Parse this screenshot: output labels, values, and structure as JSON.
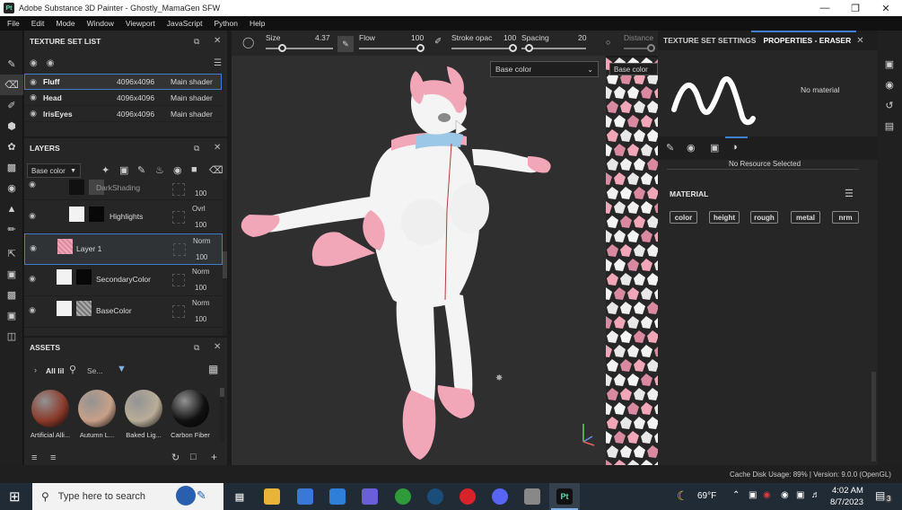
{
  "app": {
    "title": "Adobe Substance 3D Painter - Ghostly_MamaGen SFW",
    "logo_text": "Pt"
  },
  "menu": [
    "File",
    "Edit",
    "Mode",
    "Window",
    "Viewport",
    "JavaScript",
    "Python",
    "Help"
  ],
  "tool_options": {
    "size_label": "Size",
    "size_value": "4.37",
    "flow_label": "Flow",
    "flow_value": "100",
    "stroke_label": "Stroke opac",
    "stroke_value": "100",
    "spacing_label": "Spacing",
    "spacing_value": "20",
    "distance_label": "Distance"
  },
  "texture_set_list": {
    "title": "TEXTURE SET LIST",
    "rows": [
      {
        "name": "Fluff",
        "res": "4096x4096",
        "shader": "Main shader",
        "selected": true
      },
      {
        "name": "Head",
        "res": "4096x4096",
        "shader": "Main shader",
        "selected": false
      },
      {
        "name": "IrisEyes",
        "res": "4096x4096",
        "shader": "Main shader",
        "selected": false
      }
    ]
  },
  "layers": {
    "title": "LAYERS",
    "channel": "Base color",
    "items": [
      {
        "name": "DarkShading",
        "blend": "",
        "opacity": "100",
        "selected": false
      },
      {
        "name": "Highlights",
        "blend": "Ovrl",
        "opacity": "100",
        "selected": false
      },
      {
        "name": "Layer 1",
        "blend": "Norm",
        "opacity": "100",
        "selected": true
      },
      {
        "name": "SecondaryColor",
        "blend": "Norm",
        "opacity": "100",
        "selected": false
      },
      {
        "name": "BaseColor",
        "blend": "Norm",
        "opacity": "100",
        "selected": false
      }
    ]
  },
  "assets": {
    "title": "ASSETS",
    "filter_label": "All lil",
    "search_placeholder": "Se...",
    "items": [
      {
        "name": "Artificial Alli...",
        "color": "#8a3a2a"
      },
      {
        "name": "Autumn L...",
        "color": "#c8a088"
      },
      {
        "name": "Baked Lig...",
        "color": "#b9ad98"
      },
      {
        "name": "Carbon Fiber",
        "color": "#111111"
      }
    ]
  },
  "viewport": {
    "channel_select": "Base color",
    "uv_label": "Base color"
  },
  "right_panel": {
    "tab_settings": "TEXTURE SET SETTINGS",
    "tab_properties": "PROPERTIES - ERASER",
    "no_material": "No material",
    "no_resource": "No Resource Selected",
    "material_title": "MATERIAL",
    "channels": [
      "color",
      "height",
      "rough",
      "metal",
      "nrm"
    ]
  },
  "status": {
    "text": "Cache Disk Usage:   89% | Version: 9.0.0 (OpenGL)"
  },
  "taskbar": {
    "search_placeholder": "Type here to search",
    "weather": "69°F",
    "time": "4:02 AM",
    "date": "8/7/2023",
    "notifications": "3"
  },
  "colors": {
    "accent": "#3f7fd0",
    "fur_pink": "#f2a7b8",
    "fur_white": "#f4f4f4",
    "chest_blue": "#9cc8e8"
  }
}
